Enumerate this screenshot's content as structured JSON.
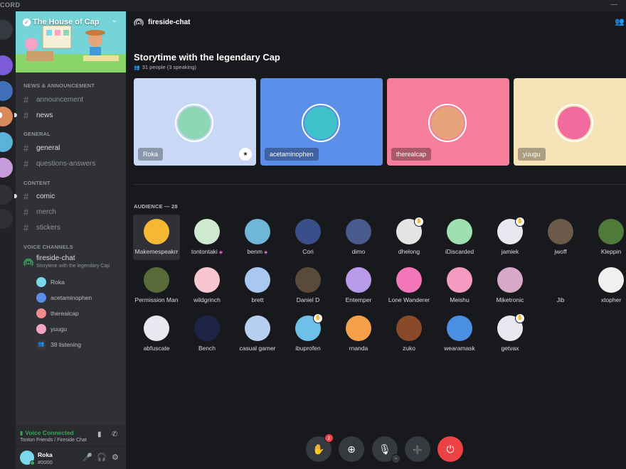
{
  "window": {
    "brand": "CORD",
    "minimize": "—",
    "maximize": "☐"
  },
  "rail": {
    "servers": [
      {
        "name": "home",
        "color": "#36393f"
      },
      {
        "name": "server-1",
        "color": "#7d5bd9"
      },
      {
        "name": "server-2",
        "color": "#3e6fb8"
      },
      {
        "name": "server-3",
        "color": "#d98a5b"
      },
      {
        "name": "server-4",
        "color": "#5bb3d9"
      },
      {
        "name": "server-5",
        "color": "#c79ad9"
      },
      {
        "name": "explore",
        "color": "#2f3136"
      },
      {
        "name": "add",
        "color": "#2f3136"
      }
    ]
  },
  "server": {
    "name": "The House of Cap",
    "check": "✓",
    "chevron": "⌄"
  },
  "categories": {
    "news": "NEWS & ANNOUNCEMENT",
    "general": "GENERAL",
    "content": "CONTENT",
    "voice": "VOICE CHANNELS"
  },
  "channels": {
    "announcement": "announcement",
    "news": "news",
    "general": "general",
    "qa": "questions-answers",
    "comic": "comic",
    "merch": "merch",
    "stickers": "stickers",
    "hash": "#"
  },
  "voice_channel": {
    "name": "fireside-chat",
    "topic": "Storytime with the legendary Cap",
    "users": [
      {
        "name": "Roka",
        "color": "#7ad8ea"
      },
      {
        "name": "acetaminophen",
        "color": "#5b8ee8"
      },
      {
        "name": "therealcap",
        "color": "#f28b8b"
      },
      {
        "name": "yuugu",
        "color": "#f5a3c7"
      }
    ],
    "listening": "38 listening"
  },
  "voice_status": {
    "title": "Voice Connected",
    "sub": "Tonton Friends / Fireside Chat"
  },
  "user": {
    "name": "Roka",
    "tag": "#0000"
  },
  "header": {
    "channel": "fireside-chat"
  },
  "stage": {
    "title": "Storytime with the legendary Cap",
    "sub": "31 people (3 speaking)"
  },
  "speakers": [
    {
      "name": "Roka",
      "bg": "#c9d8f7",
      "av": "#8fd6b4",
      "mod": true
    },
    {
      "name": "acetaminophen",
      "bg": "#5b8ee8",
      "av": "#3ec1c9",
      "mod": false
    },
    {
      "name": "therealcap",
      "bg": "#f77e9a",
      "av": "#e7a37a",
      "mod": false
    },
    {
      "name": "yuugu",
      "bg": "#f7e3b8",
      "av": "#f26b9e",
      "mod": false
    }
  ],
  "audience": {
    "label": "AUDIENCE — 28",
    "members": [
      {
        "name": "Makemespeakrr",
        "color": "#f5b833",
        "hand": false,
        "boost": false
      },
      {
        "name": "tontontaki",
        "color": "#cfe8d0",
        "hand": false,
        "boost": true
      },
      {
        "name": "benm",
        "color": "#6fb7d6",
        "hand": false,
        "boost": true
      },
      {
        "name": "Cori",
        "color": "#3a4f8a",
        "hand": false,
        "boost": false
      },
      {
        "name": "dimo",
        "color": "#4a5a8c",
        "hand": false,
        "boost": false
      },
      {
        "name": "dhelong",
        "color": "#e4e4e4",
        "hand": true,
        "boost": false
      },
      {
        "name": "iDiscarded",
        "color": "#9ee0b0",
        "hand": false,
        "boost": false
      },
      {
        "name": "jamiek",
        "color": "#e8e8f0",
        "hand": true,
        "boost": false
      },
      {
        "name": "jwoff",
        "color": "#6b5a4a",
        "hand": false,
        "boost": false
      },
      {
        "name": "Kleppin",
        "color": "#4f7a3a",
        "hand": false,
        "boost": false
      },
      {
        "name": "Permission Man",
        "color": "#5a6b3a",
        "hand": false,
        "boost": false
      },
      {
        "name": "wildgrinch",
        "color": "#f7c6d0",
        "hand": false,
        "boost": false
      },
      {
        "name": "brett",
        "color": "#a8c8f0",
        "hand": false,
        "boost": false
      },
      {
        "name": "Daniel D",
        "color": "#5a4a3a",
        "hand": false,
        "boost": false
      },
      {
        "name": "Entemper",
        "color": "#b89ae8",
        "hand": false,
        "boost": false
      },
      {
        "name": "Lone Wanderer",
        "color": "#f276b8",
        "hand": false,
        "boost": false
      },
      {
        "name": "Meishu",
        "color": "#f59ac0",
        "hand": false,
        "boost": false
      },
      {
        "name": "Miketronic",
        "color": "#d8a8c8",
        "hand": false,
        "boost": false
      },
      {
        "name": "Jib",
        "color": "#18191c",
        "hand": false,
        "boost": false
      },
      {
        "name": "xtopher",
        "color": "#f0f0f0",
        "hand": false,
        "boost": false
      },
      {
        "name": "abfuscate",
        "color": "#e8e8f0",
        "hand": false,
        "boost": false
      },
      {
        "name": "Bench",
        "color": "#1e2447",
        "hand": false,
        "boost": false
      },
      {
        "name": "casual gamer",
        "color": "#b8d0f0",
        "hand": false,
        "boost": false
      },
      {
        "name": "ibuprofen",
        "color": "#6fc0e8",
        "hand": true,
        "boost": false
      },
      {
        "name": "rnanda",
        "color": "#f5a04a",
        "hand": false,
        "boost": false
      },
      {
        "name": "zuko",
        "color": "#8a4a2a",
        "hand": false,
        "boost": false
      },
      {
        "name": "wearamask",
        "color": "#4a90e2",
        "hand": false,
        "boost": false
      },
      {
        "name": "getvax",
        "color": "#e8e8f0",
        "hand": true,
        "boost": false
      }
    ]
  },
  "controls": {
    "raise_hand_badge": "2"
  },
  "icons": {
    "hash": "#",
    "stage": "◉",
    "people": "👥",
    "hand": "✋",
    "invite": "⊕",
    "mic": "🎙",
    "add_user": "➕",
    "leave": "⏻",
    "headset": "🎧",
    "gear": "⚙",
    "mute": "🎤",
    "signal": "▮",
    "disconnect": "✆",
    "mod": "★",
    "chevron_down": "⌄",
    "listen": "👥"
  }
}
